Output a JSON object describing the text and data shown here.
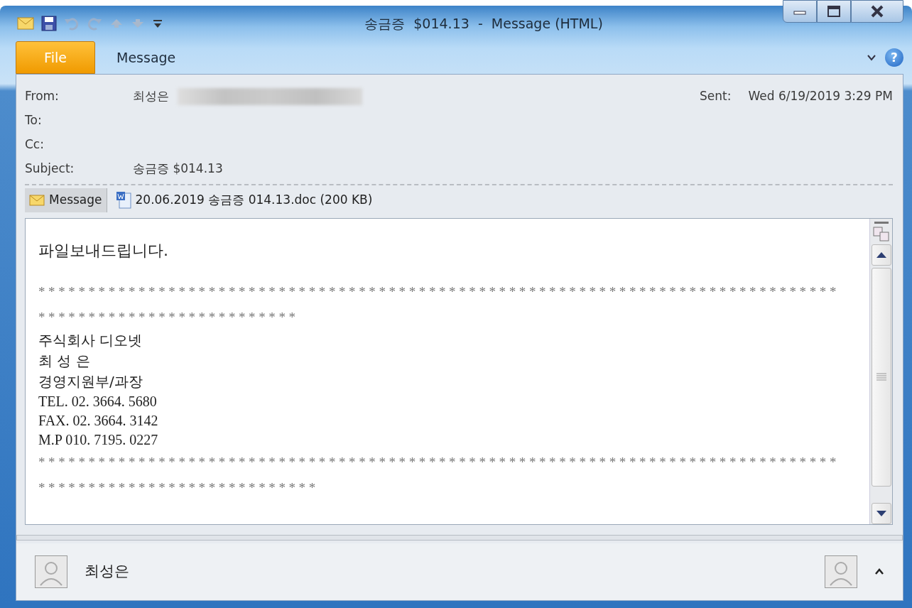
{
  "window": {
    "title": "송금증  $014.13  -  Message (HTML)",
    "help": "?"
  },
  "ribbon_tabs": [
    {
      "label": "File",
      "selected": true
    },
    {
      "label": "Message",
      "selected": false
    }
  ],
  "header": {
    "fields": [
      {
        "label": "From:",
        "value": "최성은",
        "address": {
          "kind": "redacted"
        }
      },
      {
        "label": "To:"
      },
      {
        "label": "Cc:"
      },
      {
        "label": "Subject:",
        "value": "송금증  $014.13"
      }
    ],
    "sent_label": "Sent:",
    "sent_value": "Wed 6/19/2019 3:29 PM"
  },
  "attachments": [
    {
      "kind": "message",
      "label": "Message",
      "selected": true
    },
    {
      "kind": "file",
      "label": "20.06.2019 송금증  014.13.doc (200 KB)",
      "selected": false
    }
  ],
  "body": {
    "lines": [
      {
        "kind": "greeting",
        "text": "파일보내드립니다."
      },
      {
        "kind": "stars",
        "text": "********************************************************************************"
      },
      {
        "kind": "stars",
        "text": "**************************"
      },
      {
        "kind": "text",
        "text": "주식회사 디오넷"
      },
      {
        "kind": "text",
        "text": "최 성 은"
      },
      {
        "kind": "text",
        "text": "경영지원부/과장"
      },
      {
        "kind": "contact",
        "text": "TEL. 02. 3664. 5680"
      },
      {
        "kind": "contact",
        "text": "FAX. 02. 3664. 3142"
      },
      {
        "kind": "contact",
        "text": "M.P 010. 7195. 0227"
      },
      {
        "kind": "stars",
        "text": "********************************************************************************"
      },
      {
        "kind": "stars",
        "text": "****************************"
      }
    ]
  },
  "people_pane": {
    "name": "최성은"
  }
}
